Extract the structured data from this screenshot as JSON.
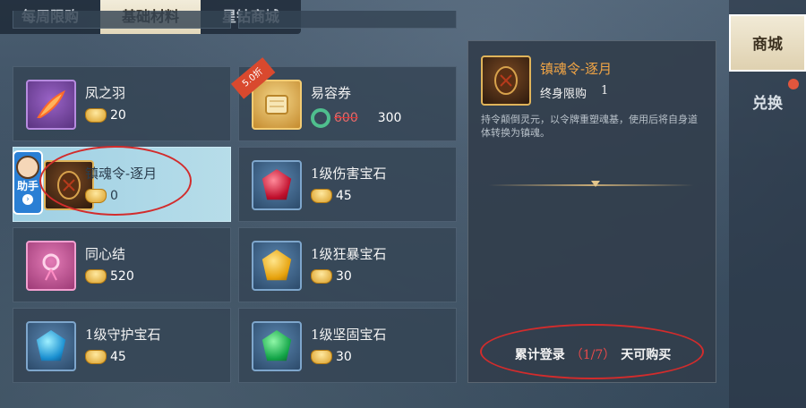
{
  "tabs": [
    {
      "label": "每周限购"
    },
    {
      "label": "基础材料"
    },
    {
      "label": "星钻商城"
    }
  ],
  "items": [
    {
      "name": "凤之羽",
      "price": "20",
      "currency": "gold-ingot",
      "icon": "phoenix-feather-icon",
      "frame": "purple"
    },
    {
      "name": "易容券",
      "price": "300",
      "old_price": "600",
      "currency": "jade",
      "icon": "scroll-icon",
      "frame": "gold",
      "ribbon": "5.0折"
    },
    {
      "name": "镇魂令-逐月",
      "price": "0",
      "currency": "gold-ingot",
      "icon": "soul-token-icon",
      "frame": "gold",
      "selected": true
    },
    {
      "name": "1级伤害宝石",
      "price": "45",
      "currency": "gold-ingot",
      "icon": "red-gem-icon",
      "frame": "blue"
    },
    {
      "name": "同心结",
      "price": "520",
      "currency": "gold-ingot",
      "icon": "knot-icon",
      "frame": "pink"
    },
    {
      "name": "1级狂暴宝石",
      "price": "30",
      "currency": "gold-ingot",
      "icon": "yellow-gem-icon",
      "frame": "blue"
    },
    {
      "name": "1级守护宝石",
      "price": "45",
      "currency": "gold-ingot",
      "icon": "cyan-gem-icon",
      "frame": "blue"
    },
    {
      "name": "1级坚固宝石",
      "price": "30",
      "currency": "gold-ingot",
      "icon": "green-gem-icon",
      "frame": "blue"
    }
  ],
  "helper": {
    "label": "助手"
  },
  "detail": {
    "name": "镇魂令-逐月",
    "limit_label": "终身限购",
    "limit_value": "1",
    "description": "持令颠倒灵元，以令牌重塑魂基，使用后将自身道体转换为镇魂。",
    "footer_prefix": "累计登录",
    "footer_count": "（1/7）",
    "footer_suffix": "天可购买"
  },
  "side_tabs": [
    {
      "label": "商城"
    },
    {
      "label": "兑换"
    }
  ],
  "colors": {
    "accent": "#f0a445",
    "highlight": "#e94a4a",
    "selected_bg": "#9fd0e4"
  }
}
